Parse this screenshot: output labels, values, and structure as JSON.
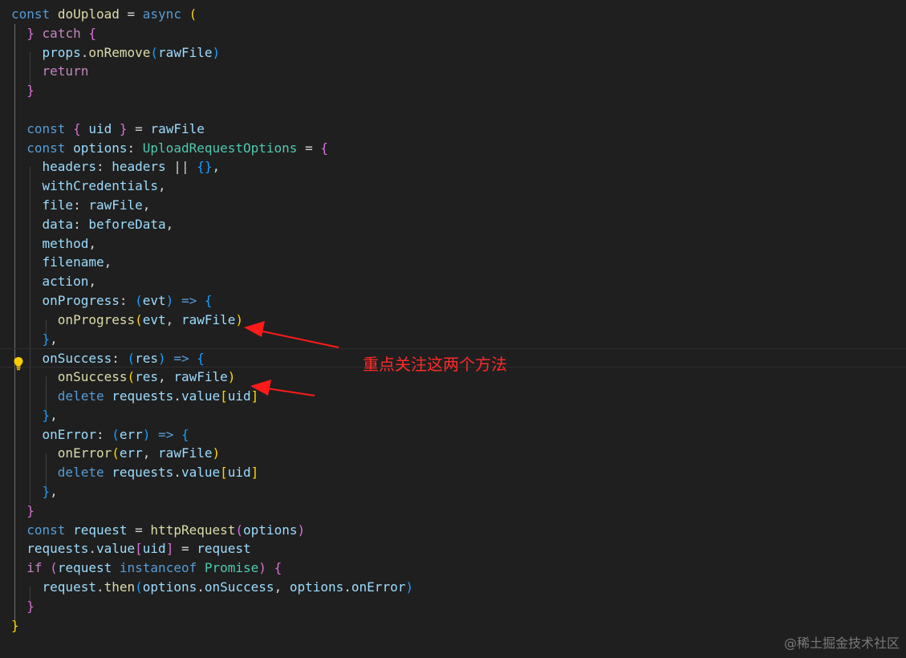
{
  "editor": {
    "lines": [
      {
        "segments": [
          {
            "t": "const",
            "c": "kw"
          },
          {
            "t": " "
          },
          {
            "t": "doUpload",
            "c": "fn"
          },
          {
            "t": " = "
          },
          {
            "t": "async",
            "c": "kw"
          },
          {
            "t": " "
          },
          {
            "t": "(",
            "c": "b1"
          }
        ]
      },
      {
        "segments": [
          {
            "t": "  "
          },
          {
            "t": "}",
            "c": "b2"
          },
          {
            "t": " "
          },
          {
            "t": "catch",
            "c": "ctl"
          },
          {
            "t": " "
          },
          {
            "t": "{",
            "c": "b2"
          }
        ]
      },
      {
        "segments": [
          {
            "t": "    "
          },
          {
            "t": "props",
            "c": "var"
          },
          {
            "t": "."
          },
          {
            "t": "onRemove",
            "c": "fn"
          },
          {
            "t": "(",
            "c": "b3"
          },
          {
            "t": "rawFile",
            "c": "var"
          },
          {
            "t": ")",
            "c": "b3"
          }
        ]
      },
      {
        "segments": [
          {
            "t": "    "
          },
          {
            "t": "return",
            "c": "ctl"
          }
        ]
      },
      {
        "segments": [
          {
            "t": "  "
          },
          {
            "t": "}",
            "c": "b2"
          }
        ]
      },
      {
        "segments": []
      },
      {
        "segments": [
          {
            "t": "  "
          },
          {
            "t": "const",
            "c": "kw"
          },
          {
            "t": " "
          },
          {
            "t": "{",
            "c": "b2"
          },
          {
            "t": " "
          },
          {
            "t": "uid",
            "c": "var"
          },
          {
            "t": " "
          },
          {
            "t": "}",
            "c": "b2"
          },
          {
            "t": " = "
          },
          {
            "t": "rawFile",
            "c": "var"
          }
        ]
      },
      {
        "segments": [
          {
            "t": "  "
          },
          {
            "t": "const",
            "c": "kw"
          },
          {
            "t": " "
          },
          {
            "t": "options",
            "c": "var"
          },
          {
            "t": ": "
          },
          {
            "t": "UploadRequestOptions",
            "c": "typ"
          },
          {
            "t": " = "
          },
          {
            "t": "{",
            "c": "b2"
          }
        ]
      },
      {
        "segments": [
          {
            "t": "    "
          },
          {
            "t": "headers",
            "c": "var"
          },
          {
            "t": ": "
          },
          {
            "t": "headers",
            "c": "var"
          },
          {
            "t": " || "
          },
          {
            "t": "{}",
            "c": "b3"
          },
          {
            "t": ","
          }
        ]
      },
      {
        "segments": [
          {
            "t": "    "
          },
          {
            "t": "withCredentials",
            "c": "var"
          },
          {
            "t": ","
          }
        ]
      },
      {
        "segments": [
          {
            "t": "    "
          },
          {
            "t": "file",
            "c": "var"
          },
          {
            "t": ": "
          },
          {
            "t": "rawFile",
            "c": "var"
          },
          {
            "t": ","
          }
        ]
      },
      {
        "segments": [
          {
            "t": "    "
          },
          {
            "t": "data",
            "c": "var"
          },
          {
            "t": ": "
          },
          {
            "t": "beforeData",
            "c": "var"
          },
          {
            "t": ","
          }
        ]
      },
      {
        "segments": [
          {
            "t": "    "
          },
          {
            "t": "method",
            "c": "var"
          },
          {
            "t": ","
          }
        ]
      },
      {
        "segments": [
          {
            "t": "    "
          },
          {
            "t": "filename",
            "c": "var"
          },
          {
            "t": ","
          }
        ]
      },
      {
        "segments": [
          {
            "t": "    "
          },
          {
            "t": "action",
            "c": "var"
          },
          {
            "t": ","
          }
        ]
      },
      {
        "segments": [
          {
            "t": "    "
          },
          {
            "t": "onProgress",
            "c": "var"
          },
          {
            "t": ": "
          },
          {
            "t": "(",
            "c": "b3"
          },
          {
            "t": "evt",
            "c": "var"
          },
          {
            "t": ")",
            "c": "b3"
          },
          {
            "t": " "
          },
          {
            "t": "=>",
            "c": "kw"
          },
          {
            "t": " "
          },
          {
            "t": "{",
            "c": "b3"
          }
        ]
      },
      {
        "segments": [
          {
            "t": "      "
          },
          {
            "t": "onProgress",
            "c": "fn"
          },
          {
            "t": "(",
            "c": "b1"
          },
          {
            "t": "evt",
            "c": "var"
          },
          {
            "t": ", "
          },
          {
            "t": "rawFile",
            "c": "var"
          },
          {
            "t": ")",
            "c": "b1"
          }
        ]
      },
      {
        "segments": [
          {
            "t": "    "
          },
          {
            "t": "}",
            "c": "b3"
          },
          {
            "t": ","
          }
        ]
      },
      {
        "current": true,
        "segments": [
          {
            "t": "    "
          },
          {
            "t": "onSuccess",
            "c": "var"
          },
          {
            "t": ": "
          },
          {
            "t": "(",
            "c": "b3"
          },
          {
            "t": "res",
            "c": "var"
          },
          {
            "t": ")",
            "c": "b3"
          },
          {
            "t": " "
          },
          {
            "t": "=>",
            "c": "kw"
          },
          {
            "t": " "
          },
          {
            "t": "{",
            "c": "b3"
          }
        ]
      },
      {
        "segments": [
          {
            "t": "      "
          },
          {
            "t": "onSuccess",
            "c": "fn"
          },
          {
            "t": "(",
            "c": "b1"
          },
          {
            "t": "res",
            "c": "var"
          },
          {
            "t": ", "
          },
          {
            "t": "rawFile",
            "c": "var"
          },
          {
            "t": ")",
            "c": "b1"
          }
        ]
      },
      {
        "segments": [
          {
            "t": "      "
          },
          {
            "t": "delete",
            "c": "kw"
          },
          {
            "t": " "
          },
          {
            "t": "requests",
            "c": "var"
          },
          {
            "t": "."
          },
          {
            "t": "value",
            "c": "var"
          },
          {
            "t": "[",
            "c": "b1"
          },
          {
            "t": "uid",
            "c": "var"
          },
          {
            "t": "]",
            "c": "b1"
          }
        ]
      },
      {
        "segments": [
          {
            "t": "    "
          },
          {
            "t": "}",
            "c": "b3"
          },
          {
            "t": ","
          }
        ]
      },
      {
        "segments": [
          {
            "t": "    "
          },
          {
            "t": "onError",
            "c": "var"
          },
          {
            "t": ": "
          },
          {
            "t": "(",
            "c": "b3"
          },
          {
            "t": "err",
            "c": "var"
          },
          {
            "t": ")",
            "c": "b3"
          },
          {
            "t": " "
          },
          {
            "t": "=>",
            "c": "kw"
          },
          {
            "t": " "
          },
          {
            "t": "{",
            "c": "b3"
          }
        ]
      },
      {
        "segments": [
          {
            "t": "      "
          },
          {
            "t": "onError",
            "c": "fn"
          },
          {
            "t": "(",
            "c": "b1"
          },
          {
            "t": "err",
            "c": "var"
          },
          {
            "t": ", "
          },
          {
            "t": "rawFile",
            "c": "var"
          },
          {
            "t": ")",
            "c": "b1"
          }
        ]
      },
      {
        "segments": [
          {
            "t": "      "
          },
          {
            "t": "delete",
            "c": "kw"
          },
          {
            "t": " "
          },
          {
            "t": "requests",
            "c": "var"
          },
          {
            "t": "."
          },
          {
            "t": "value",
            "c": "var"
          },
          {
            "t": "[",
            "c": "b1"
          },
          {
            "t": "uid",
            "c": "var"
          },
          {
            "t": "]",
            "c": "b1"
          }
        ]
      },
      {
        "segments": [
          {
            "t": "    "
          },
          {
            "t": "}",
            "c": "b3"
          },
          {
            "t": ","
          }
        ]
      },
      {
        "segments": [
          {
            "t": "  "
          },
          {
            "t": "}",
            "c": "b2"
          }
        ]
      },
      {
        "segments": [
          {
            "t": "  "
          },
          {
            "t": "const",
            "c": "kw"
          },
          {
            "t": " "
          },
          {
            "t": "request",
            "c": "var"
          },
          {
            "t": " = "
          },
          {
            "t": "httpRequest",
            "c": "fn"
          },
          {
            "t": "(",
            "c": "b2"
          },
          {
            "t": "options",
            "c": "var"
          },
          {
            "t": ")",
            "c": "b2"
          }
        ]
      },
      {
        "segments": [
          {
            "t": "  "
          },
          {
            "t": "requests",
            "c": "var"
          },
          {
            "t": "."
          },
          {
            "t": "value",
            "c": "var"
          },
          {
            "t": "[",
            "c": "b2"
          },
          {
            "t": "uid",
            "c": "var"
          },
          {
            "t": "]",
            "c": "b2"
          },
          {
            "t": " = "
          },
          {
            "t": "request",
            "c": "var"
          }
        ]
      },
      {
        "segments": [
          {
            "t": "  "
          },
          {
            "t": "if",
            "c": "ctl"
          },
          {
            "t": " "
          },
          {
            "t": "(",
            "c": "b2"
          },
          {
            "t": "request",
            "c": "var"
          },
          {
            "t": " "
          },
          {
            "t": "instanceof",
            "c": "kw"
          },
          {
            "t": " "
          },
          {
            "t": "Promise",
            "c": "typ"
          },
          {
            "t": ")",
            "c": "b2"
          },
          {
            "t": " "
          },
          {
            "t": "{",
            "c": "b2"
          }
        ]
      },
      {
        "segments": [
          {
            "t": "    "
          },
          {
            "t": "request",
            "c": "var"
          },
          {
            "t": "."
          },
          {
            "t": "then",
            "c": "fn"
          },
          {
            "t": "(",
            "c": "b3"
          },
          {
            "t": "options",
            "c": "var"
          },
          {
            "t": "."
          },
          {
            "t": "onSuccess",
            "c": "var"
          },
          {
            "t": ", "
          },
          {
            "t": "options",
            "c": "var"
          },
          {
            "t": "."
          },
          {
            "t": "onError",
            "c": "var"
          },
          {
            "t": ")",
            "c": "b3"
          }
        ]
      },
      {
        "segments": [
          {
            "t": "  "
          },
          {
            "t": "}",
            "c": "b2"
          }
        ]
      },
      {
        "segments": [
          {
            "t": "}",
            "c": "b1"
          }
        ]
      }
    ]
  },
  "annotation": {
    "text": "重点关注这两个方法",
    "color": "#ff2a2a"
  },
  "watermark": {
    "text": "@稀土掘金技术社区"
  },
  "icons": {
    "lightbulb": "lightbulb-icon"
  },
  "theme": {
    "background": "#1f1f1f",
    "keyword": "#569cd6",
    "control": "#c586c0",
    "function": "#dcdcaa",
    "variable": "#9cdcfe",
    "type": "#4ec9b0"
  }
}
